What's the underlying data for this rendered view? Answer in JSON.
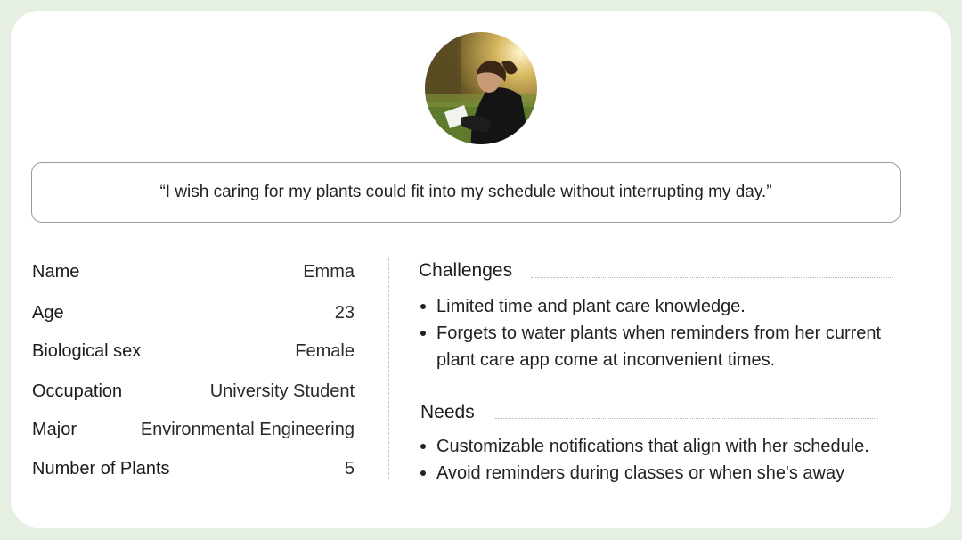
{
  "quote": "“I wish caring for my plants could fit into my schedule without interrupting my day.”",
  "profile": [
    {
      "label": "Name",
      "value": "Emma"
    },
    {
      "label": "Age",
      "value": "23"
    },
    {
      "label": "Biological sex",
      "value": "Female"
    },
    {
      "label": "Occupation",
      "value": "University Student"
    },
    {
      "label": "Major",
      "value": "Environmental Engineering"
    },
    {
      "label": "Number of Plants",
      "value": "5"
    }
  ],
  "challenges": {
    "title": "Challenges",
    "items": [
      "Limited time and plant care knowledge.",
      "Forgets to water plants when reminders from her current plant care app come at inconvenient times."
    ]
  },
  "needs": {
    "title": "Needs",
    "items": [
      "Customizable notifications that align with her schedule.",
      "Avoid reminders during classes or when she's away"
    ]
  },
  "colors": {
    "background": "#e6f0e2",
    "card": "#ffffff",
    "border": "#9a9a9a"
  }
}
